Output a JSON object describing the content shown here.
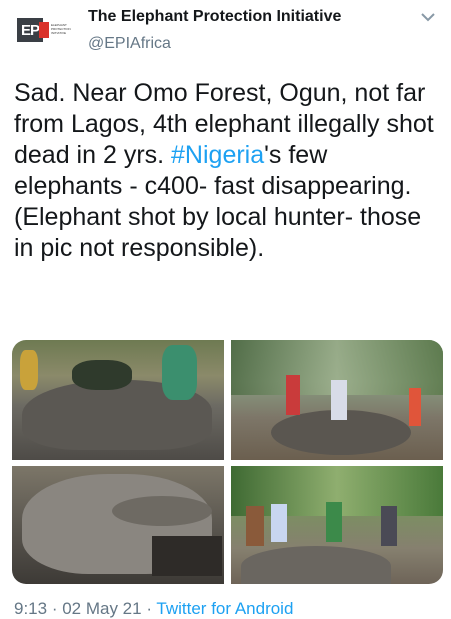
{
  "account": {
    "display_name": "The Elephant Protection Initiative",
    "handle": "@EPIAfrica",
    "logo_text": "EP",
    "logo_subtext": "ELEPHANT PROTECTION INITIATIVE"
  },
  "tweet": {
    "text_before_hashtag": "Sad. Near Omo Forest, Ogun, not far from Lagos, 4th elephant illegally shot dead in 2 yrs. ",
    "hashtag": "#Nigeria",
    "text_after_hashtag": "'s few elephants - c400- fast disappearing. (Elephant shot by local hunter- those in pic not responsible)."
  },
  "meta": {
    "time": "9:13",
    "separator1": " · ",
    "date": "02 May 21",
    "separator2": " · ",
    "source": "Twitter for Android"
  },
  "colors": {
    "link": "#1da1f2",
    "secondary_text": "#657786",
    "logo_red": "#d9322b"
  },
  "icons": {
    "more": "chevron-down-icon"
  }
}
